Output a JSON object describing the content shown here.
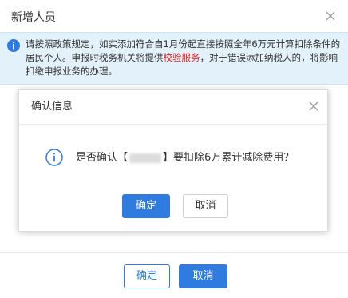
{
  "outer_dialog": {
    "title": "新增人员",
    "notice": {
      "text_before": "请按照政策规定，如实添加符合自1月份起直接按照全年6万元计算扣除条件的居民个人。申报时税务机关将提供",
      "link": "校验服务",
      "text_after": "，对于错误添加纳税人的，将影响扣缴申报业务的办理。"
    },
    "footer": {
      "confirm_label": "确定",
      "cancel_label": "取消"
    }
  },
  "modal": {
    "title": "确认信息",
    "message_prefix": "是否确认【",
    "message_suffix": "】要扣除6万累计减除费用？",
    "confirm_label": "确定",
    "cancel_label": "取消"
  },
  "colors": {
    "primary": "#2f7be0",
    "notice_bg": "#e3f1fb",
    "link_red": "#e02020"
  },
  "icons": {
    "close": "close-icon",
    "info": "info-icon"
  }
}
